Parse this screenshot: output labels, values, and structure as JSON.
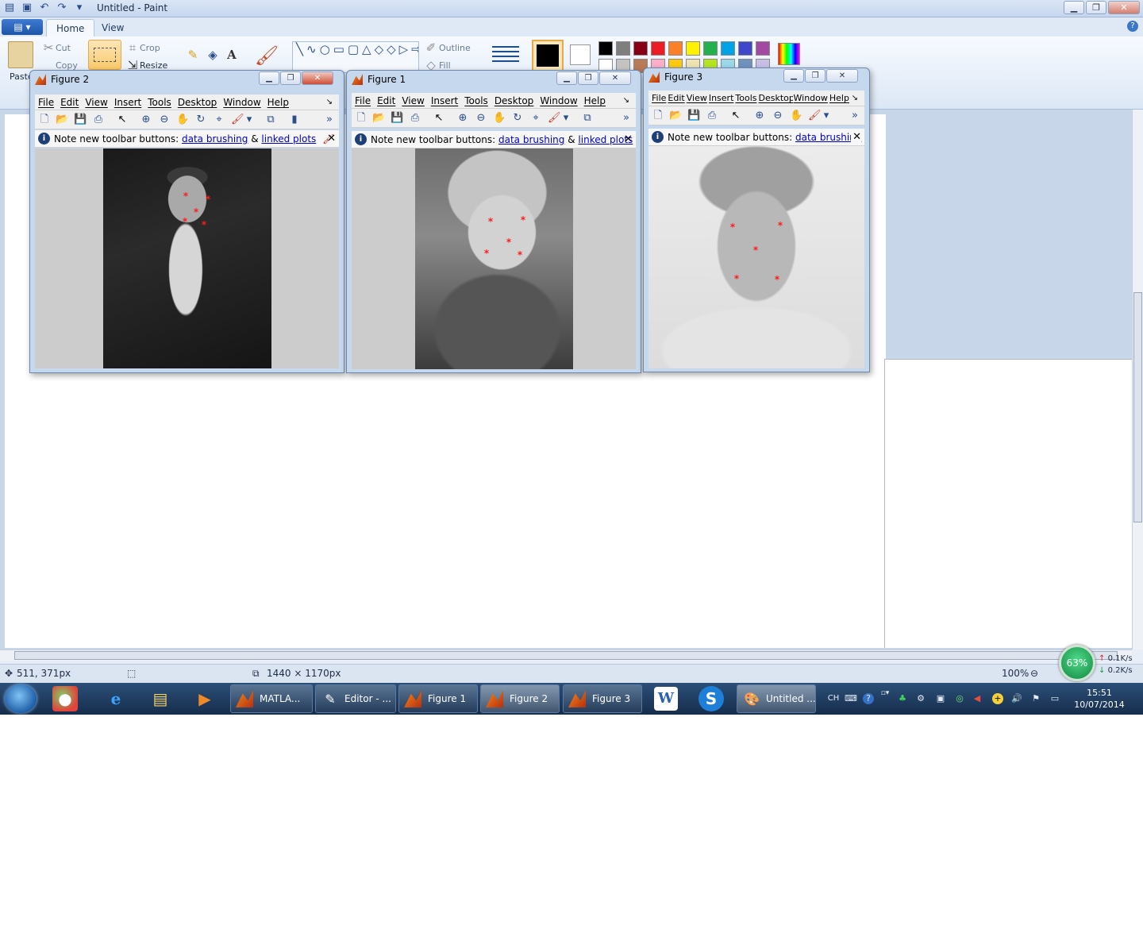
{
  "paint": {
    "title": "Untitled - Paint",
    "tabs": [
      "Home",
      "View"
    ],
    "clipboard": {
      "paste": "Paste",
      "cut": "Cut",
      "copy": "Copy"
    },
    "image": {
      "crop": "Crop",
      "resize": "Resize"
    },
    "shapes": {
      "outline": "Outline",
      "fill": "Fill"
    },
    "palette": [
      "#000000",
      "#7f7f7f",
      "#880015",
      "#ed1c24",
      "#ff7f27",
      "#fff200",
      "#22b14c",
      "#00a2e8",
      "#3f48cc",
      "#a349a4",
      "#ffffff",
      "#c3c3c3",
      "#b97a57",
      "#ffaec9",
      "#ffc90e",
      "#efe4b0",
      "#b5e61d",
      "#99d9ea",
      "#7092be",
      "#c8bfe7"
    ],
    "status": {
      "cursor_pos": "511, 371px",
      "image_size": "1440 × 1170px",
      "zoom": "100%"
    }
  },
  "monitor": {
    "cpu": "63%",
    "up": "0.1K/s",
    "down": "0.2K/s"
  },
  "figures": {
    "menu": [
      "File",
      "Edit",
      "View",
      "Insert",
      "Tools",
      "Desktop",
      "Window",
      "Help"
    ],
    "menu_fig3": [
      "File",
      "Edit",
      "View",
      "Insert",
      "Tools",
      "Desktop",
      "Window",
      "Help"
    ],
    "note_text": "Note new toolbar buttons:",
    "brushing": "data brushing",
    "amp": "&",
    "linked": "linked plots",
    "fig2": {
      "title": "Figure 2"
    },
    "fig1": {
      "title": "Figure 1"
    },
    "fig3": {
      "title": "Figure 3"
    }
  },
  "taskbar": {
    "tasks": [
      "MATLA...",
      "Editor - ...",
      "Figure 1",
      "Figure 2",
      "Figure 3",
      "Untitled ..."
    ],
    "lang": "CH",
    "time": "15:51",
    "date": "10/07/2014"
  }
}
